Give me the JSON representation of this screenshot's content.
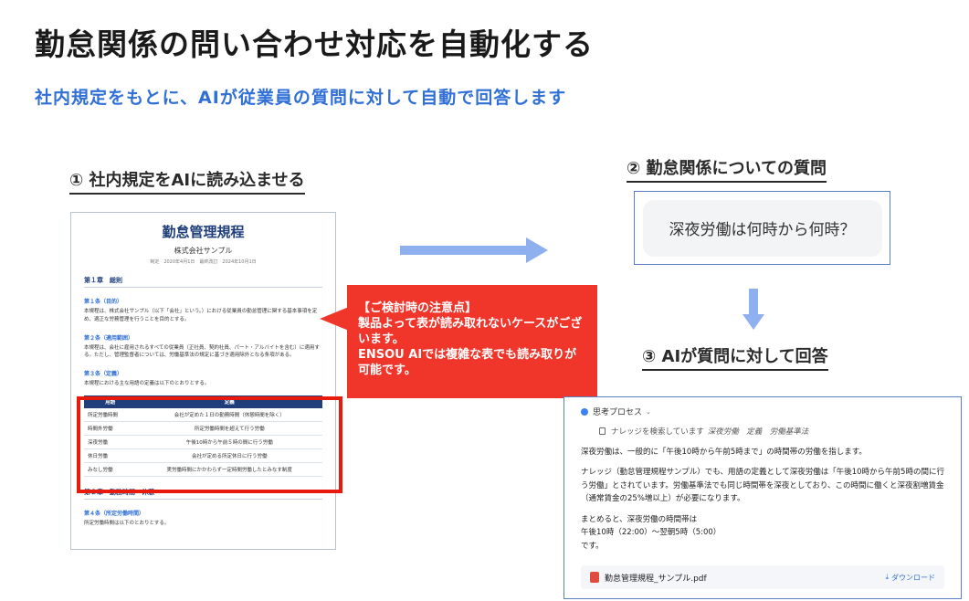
{
  "header": {
    "title": "勤怠関係の問い合わせ対応を自動化する",
    "subtitle": "社内規定をもとに、AIが従業員の質問に対して自動で回答します"
  },
  "steps": {
    "step1": "① 社内規定をAIに読み込ませる",
    "step2": "② 勤怠関係についての質問",
    "step3": "③ AIが質問に対して回答"
  },
  "document": {
    "title": "勤怠管理規程",
    "company": "株式会社サンプル",
    "meta": "制定　2020年4月1日　最終改訂　2024年10月1日",
    "chapter1": "第１章　総則",
    "article1_title": "第１条（目的）",
    "article1_text": "本規程は、株式会社サンプル（以下「会社」という。）における従業員の勤怠管理に関する基本事項を定め、適正な労務管理を行うことを目的とする。",
    "article2_title": "第２条（適用範囲）",
    "article2_text": "本規程は、会社に雇用されるすべての従業員（正社員、契約社員、パート・アルバイトを含む）に適用する。ただし、管理監督者については、労働基準法の規定に基づき適用除外となる条項がある。",
    "article3_title": "第３条（定義）",
    "article3_text": "本規程における主な用語の定義は以下のとおりとする。",
    "table_headers": [
      "用語",
      "定義"
    ],
    "table_rows": [
      [
        "所定労働時間",
        "会社が定めた１日の勤務時間（休憩時間を除く）"
      ],
      [
        "時間外労働",
        "所定労働時間を超えて行う労働"
      ],
      [
        "深夜労働",
        "午後10時から午前５時の間に行う労働"
      ],
      [
        "休日労働",
        "会社が定める所定休日に行う労働"
      ],
      [
        "みなし労働",
        "実労働時間にかかわらず一定時間労働したとみなす制度"
      ]
    ],
    "chapter2": "第２章　勤務時間・休憩",
    "article4_title": "第４条（所定労働時間）",
    "article4_text": "所定労働時間は以下のとおりとする。"
  },
  "callout": {
    "title": "【ご検討時の注意点】",
    "body1": "製品よって表が読み取れないケースがございます。",
    "body2": "ENSOU AIでは複雑な表でも読み取りが可能です。"
  },
  "question": {
    "text": "深夜労働は何時から何時？"
  },
  "answer": {
    "thinking_label": "思考プロセス",
    "search_prefix": "ナレッジを検索しています",
    "search_terms": "深夜労働　定義　労働基準法",
    "para1": "深夜労働は、一般的に「午後10時から午前5時まで」の時間帯の労働を指します。",
    "para2": "ナレッジ（勤怠管理規程サンプル）でも、用語の定義として深夜労働は「午後10時から午前5時の間に行う労働」とされています。労働基準法でも同じ時間帯を深夜としており、この時間に働くと深夜割増賃金（通常賃金の25%増以上）が必要になります。",
    "para3_line1": "まとめると、深夜労働の時間帯は",
    "para3_line2": "午後10時（22:00）〜翌朝5時（5:00）",
    "para3_line3": "です。",
    "file_name": "勤怠管理規程_サンプル.pdf",
    "download_label": "ダウンロード"
  },
  "colors": {
    "accent_blue": "#2f6fd6",
    "callout_red": "#f0352a",
    "frame_red": "#e8190d",
    "arrow_blue": "#8fb0ee"
  }
}
